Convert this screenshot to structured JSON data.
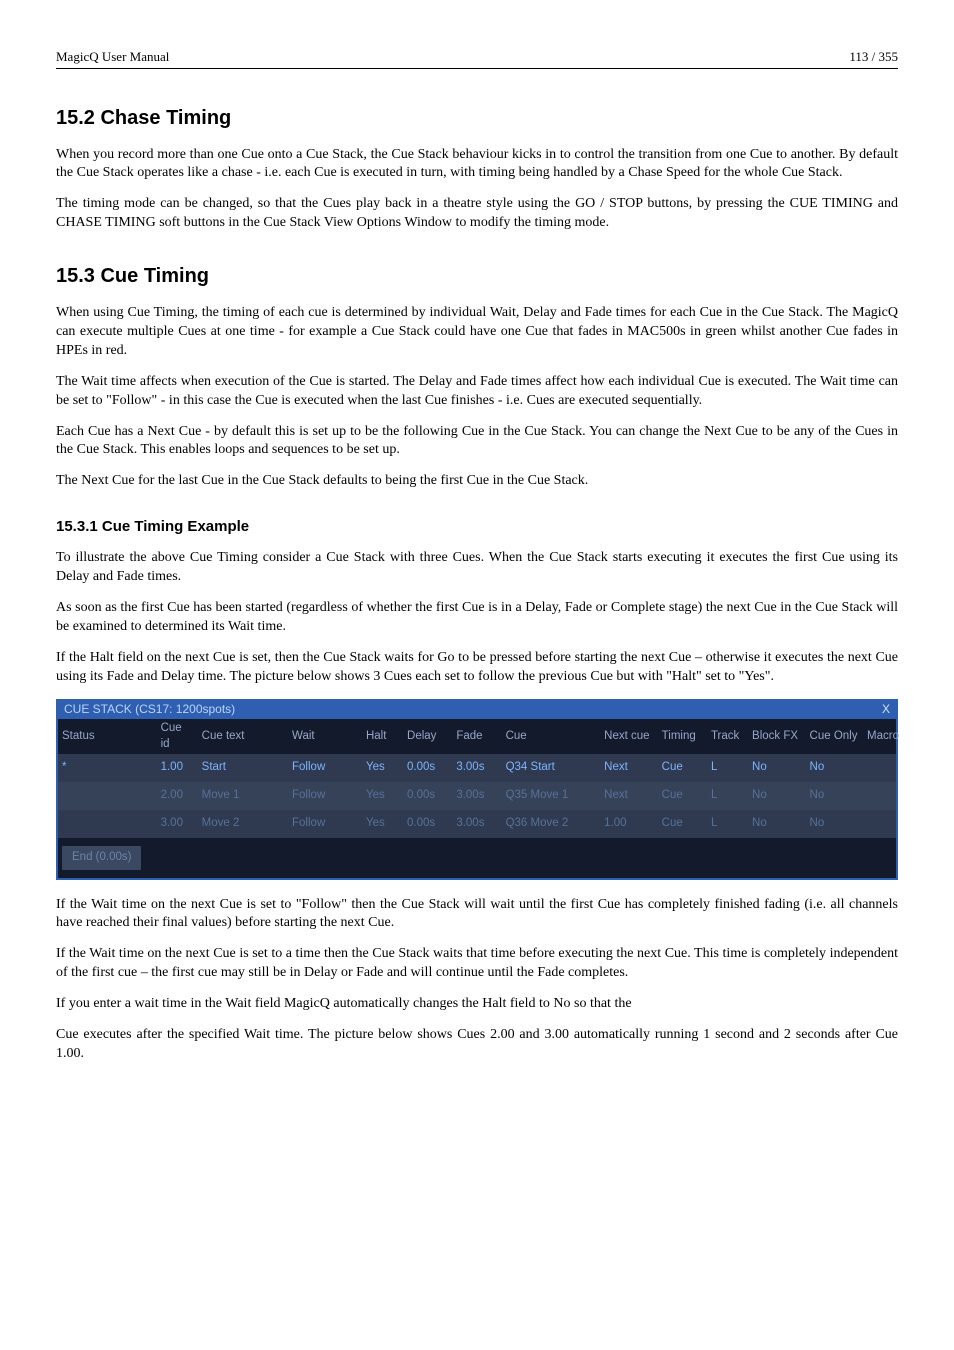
{
  "header": {
    "left": "MagicQ User Manual",
    "right": "113 / 355"
  },
  "s152": {
    "heading": "15.2   Chase Timing",
    "p1": "When you record more than one Cue onto a Cue Stack, the Cue Stack behaviour kicks in to control the transition from one Cue to another. By default the Cue Stack operates like a chase - i.e. each Cue is executed in turn, with timing being handled by a Chase Speed for the whole Cue Stack.",
    "p2": "The timing mode can be changed, so that the Cues play back in a theatre style using the GO / STOP buttons, by pressing the CUE TIMING and CHASE TIMING soft buttons in the Cue Stack View Options Window to modify the timing mode."
  },
  "s153": {
    "heading": "15.3   Cue Timing",
    "p1": "When using Cue Timing, the timing of each cue is determined by individual Wait, Delay and Fade times for each Cue in the Cue Stack. The MagicQ can execute multiple Cues at one time - for example a Cue Stack could have one Cue that fades in MAC500s in green whilst another Cue fades in HPEs in red.",
    "p2": "The Wait time affects when execution of the Cue is started. The Delay and Fade times affect how each individual Cue is executed. The Wait time can be set to \"Follow\" - in this case the Cue is executed when the last Cue finishes - i.e. Cues are executed sequentially.",
    "p3": "Each Cue has a Next Cue - by default this is set up to be the following Cue in the Cue Stack. You can change the Next Cue to be any of the Cues in the Cue Stack. This enables loops and sequences to be set up.",
    "p4": "The Next Cue for the last Cue in the Cue Stack defaults to being the first Cue in the Cue Stack."
  },
  "s1531": {
    "heading": "15.3.1   Cue Timing Example",
    "p1": "To illustrate the above Cue Timing consider a Cue Stack with three Cues. When the Cue Stack starts executing it executes the first Cue using its Delay and Fade times.",
    "p2": "As soon as the first Cue has been started (regardless of whether the first Cue is in a Delay, Fade or Complete stage) the next Cue in the Cue Stack will be examined to determined its Wait time.",
    "p3": "If the Halt field on the next Cue is set, then the Cue Stack waits for Go to be pressed before starting the next Cue – otherwise it executes the next Cue using its Fade and Delay time. The picture below shows 3 Cues each set to follow the previous Cue but with \"Halt\" set to \"Yes\"."
  },
  "cuestack": {
    "title": "CUE STACK (CS17: 1200spots)",
    "close": "X",
    "headers": {
      "status": "Status",
      "cueid": "Cue id",
      "cuetext": "Cue text",
      "wait": "Wait",
      "halt": "Halt",
      "delay": "Delay",
      "fade": "Fade",
      "cue": "Cue",
      "nextcue": "Next cue",
      "timing": "Timing",
      "track": "Track",
      "blockfx": "Block FX",
      "cueonly": "Cue Only",
      "macro": "Macro"
    },
    "rows": [
      {
        "status": "*",
        "cueid": "1.00",
        "cuetext": "Start",
        "wait": "Follow",
        "halt": "Yes",
        "delay": "0.00s",
        "fade": "3.00s",
        "cue": "Q34 Start",
        "nextcue": "Next",
        "timing": "Cue",
        "track": "L",
        "blockfx": "No",
        "cueonly": "No",
        "macro": ""
      },
      {
        "status": "",
        "cueid": "2.00",
        "cuetext": "Move 1",
        "wait": "Follow",
        "halt": "Yes",
        "delay": "0.00s",
        "fade": "3.00s",
        "cue": "Q35 Move 1",
        "nextcue": "Next",
        "timing": "Cue",
        "track": "L",
        "blockfx": "No",
        "cueonly": "No",
        "macro": ""
      },
      {
        "status": "",
        "cueid": "3.00",
        "cuetext": "Move 2",
        "wait": "Follow",
        "halt": "Yes",
        "delay": "0.00s",
        "fade": "3.00s",
        "cue": "Q36 Move 2",
        "nextcue": "1.00",
        "timing": "Cue",
        "track": "L",
        "blockfx": "No",
        "cueonly": "No",
        "macro": ""
      }
    ],
    "end": "End (0.00s)"
  },
  "after": {
    "p1": "If the Wait time on the next Cue is set to \"Follow\" then the Cue Stack will wait until the first Cue has completely finished fading (i.e. all channels have reached their final values) before starting the next Cue.",
    "p2": "If the Wait time on the next Cue is set to a time then the Cue Stack waits that time before executing the next Cue. This time is completely independent of the first cue – the first cue may still be in Delay or Fade and will continue until the Fade completes.",
    "p3": "If you enter a wait time in the Wait field MagicQ automatically changes the Halt field to No so that the",
    "p4": "Cue executes after the specified Wait time. The picture below shows Cues 2.00 and 3.00 automatically running 1 second and 2 seconds after Cue 1.00."
  }
}
